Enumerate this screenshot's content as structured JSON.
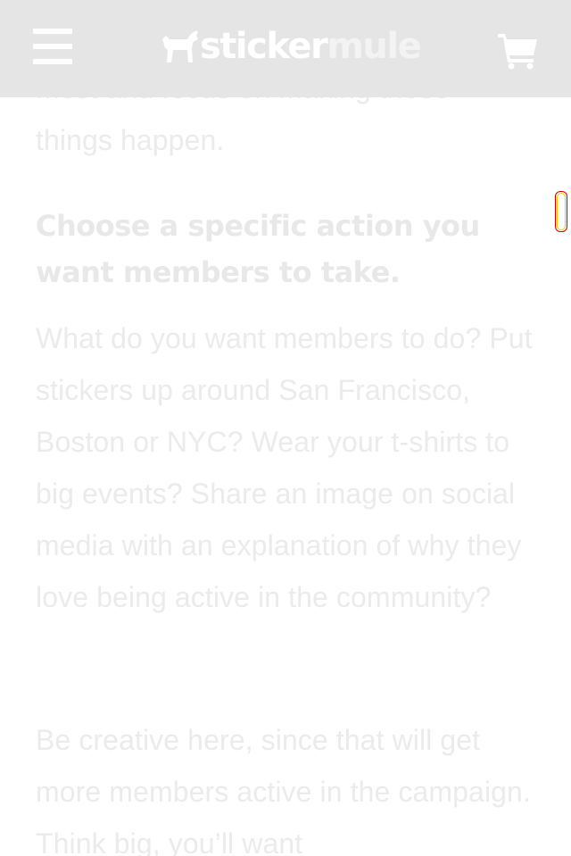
{
  "header": {
    "menu_icon": "hamburger-menu-icon",
    "logo_part1": "sticker",
    "logo_part2": "mule",
    "logo_icon": "mule-icon",
    "cart_icon": "shopping-cart-icon",
    "background_color": "#e5e5e5"
  },
  "article": {
    "partial_top_line": "most and focus on making those",
    "paragraph_1_end": "things happen.",
    "heading": "Choose a specific action you want members to take.",
    "paragraph_2": "What do you want members to do? Put stickers up around San Francisco, Boston or NYC? Wear your t-shirts to big events? Share an image on social media with an explanation of why they love being active in the community?",
    "paragraph_3": "Be creative here, since that will get more members active in the campaign. Think big, you’ll want",
    "text_color": "#ebebeb"
  }
}
